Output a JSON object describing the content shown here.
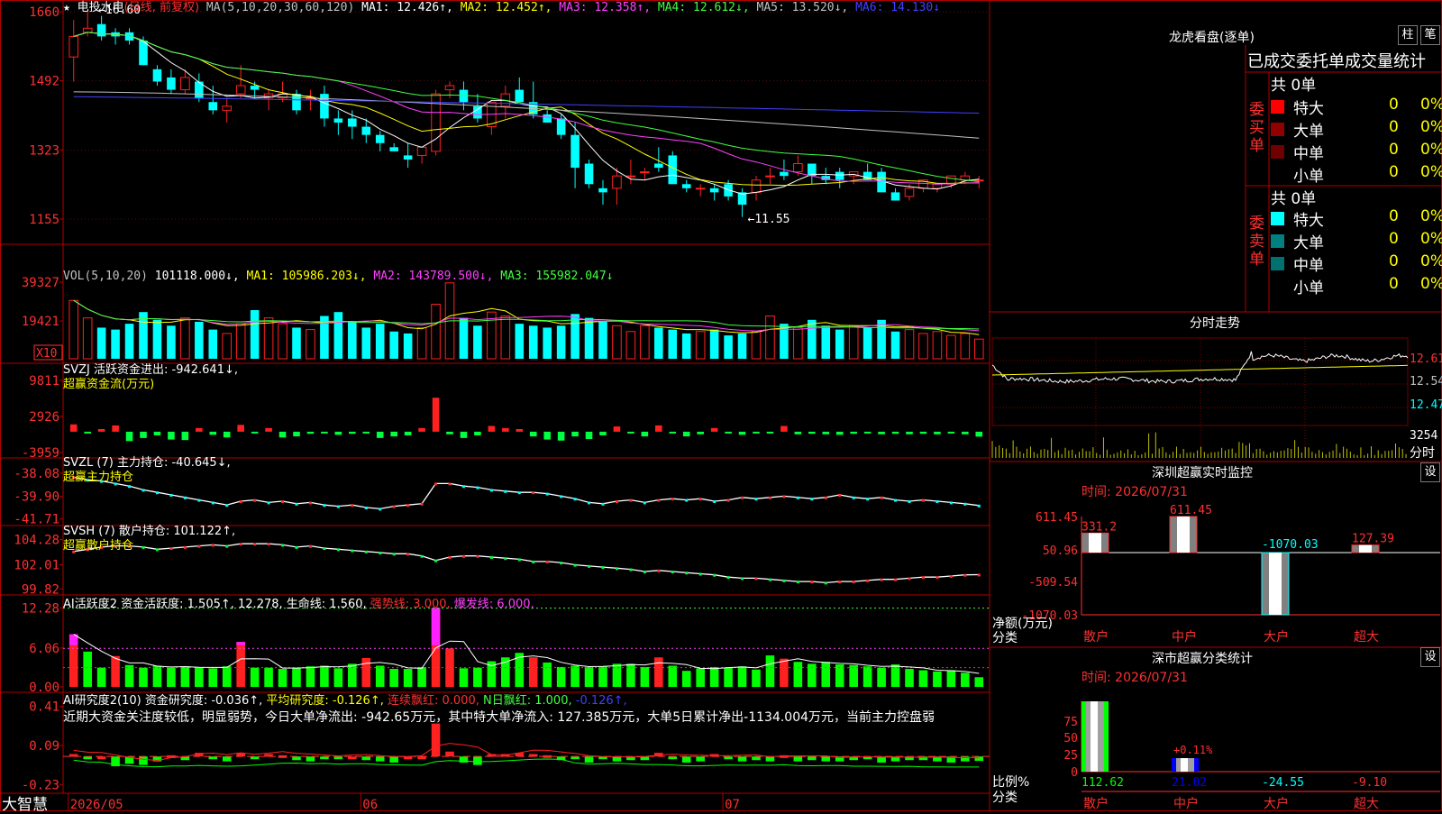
{
  "stock": {
    "name": "电投水电",
    "period": "(日线, 前复权)",
    "star": "★"
  },
  "colors": {
    "up": "#ff2020",
    "down": "#00ffff",
    "ma1": "#ffffff",
    "ma2": "#ffff00",
    "ma3": "#ff40ff",
    "ma4": "#40ff40",
    "ma5": "#c0c0c0",
    "ma6": "#4040ff",
    "grid": "#a01010",
    "border": "#b00000"
  },
  "ma_header": {
    "params": "MA(5,10,20,30,60,120)",
    "items": [
      {
        "label": "MA1:",
        "value": "12.426↑,",
        "color": "#ffffff"
      },
      {
        "label": "MA2:",
        "value": "12.452↑,",
        "color": "#ffff00"
      },
      {
        "label": "MA3:",
        "value": "12.358↑,",
        "color": "#ff40ff"
      },
      {
        "label": "MA4:",
        "value": "12.612↓,",
        "color": "#40ff40"
      },
      {
        "label": "MA5:",
        "value": "13.520↓,",
        "color": "#c0c0c0"
      },
      {
        "label": "MA6:",
        "value": "14.130↓",
        "color": "#4040ff"
      }
    ]
  },
  "vol_header": {
    "params": "VOL(5,10,20)",
    "value": "101118.000↓,",
    "items": [
      {
        "label": "MA1:",
        "value": "105986.203↓,",
        "color": "#ffff00"
      },
      {
        "label": "MA2:",
        "value": "143789.500↓,",
        "color": "#ff40ff"
      },
      {
        "label": "MA3:",
        "value": "155982.047↓",
        "color": "#40ff40"
      }
    ]
  },
  "svzj_header": {
    "line1": "SVZJ  活跃资金进出: -942.641↓,",
    "line2": "超赢资金流(万元)"
  },
  "svzl_header": {
    "line1": "SVZL (7) 主力持仓: -40.645↓,",
    "line2": "超赢主力持仓"
  },
  "svsh_header": {
    "line1": "SVSH (7) 散户持仓: 101.122↑,",
    "line2": "超赢散户持仓"
  },
  "ai1_header": {
    "a": "AI活跃度2 资金活跃度: 1.505↑, 12.278, 生命线: 1.560,",
    "b": "强势线: 3.000,",
    "c": "爆发线: 6.000,"
  },
  "ai2_header": {
    "a": "AI研究度2(10) 资金研究度: -0.036↑,",
    "b": "平均研究度: -0.126↑,",
    "c": "连续飘红: 0.000,",
    "d": "N日飘红: 1.000,",
    "e": "-0.126↑,"
  },
  "ai2_comment": "近期大资金关注度较低，明显弱势，今日大单净流出: -942.65万元，其中特大单净流入: 127.385万元，大单5日累计净出-1134.004万元，当前主力控盘弱",
  "axes": {
    "price": [
      "1660",
      "1492",
      "1323",
      "1155"
    ],
    "vol": [
      "39327",
      "19421"
    ],
    "vol_unit": "X10",
    "svzj": [
      "9811",
      "2926",
      "-3959"
    ],
    "svzl": [
      "-38.08",
      "-39.90",
      "-41.71"
    ],
    "svsh": [
      "104.28",
      "102.01",
      "99.82"
    ],
    "ai1": [
      "12.28",
      "6.06",
      "0.00"
    ],
    "ai2": [
      "0.41",
      "0.09",
      "-0.23"
    ],
    "dates": [
      "2026/05",
      "06",
      "07"
    ]
  },
  "price_annotations": {
    "high": "16.60",
    "low": "11.55"
  },
  "brand": "大智慧",
  "right_panel": {
    "lhb": {
      "title": "龙虎看盘(逐单)",
      "btn1": "柱",
      "btn2": "笔",
      "tabs": "已成交委托单成交量统计",
      "buy": {
        "side": "委买单",
        "total": "共 0单",
        "rows": [
          {
            "label": "特大",
            "v": "0",
            "p": "0%",
            "color": "#ff0000"
          },
          {
            "label": "大单",
            "v": "0",
            "p": "0%",
            "color": "#900000"
          },
          {
            "label": "中单",
            "v": "0",
            "p": "0%",
            "color": "#700000"
          },
          {
            "label": "小单",
            "v": "0",
            "p": "0%",
            "color": ""
          }
        ]
      },
      "sell": {
        "side": "委卖单",
        "total": "共 0单",
        "rows": [
          {
            "label": "特大",
            "v": "0",
            "p": "0%",
            "color": "#00ffff"
          },
          {
            "label": "大单",
            "v": "0",
            "p": "0%",
            "color": "#008080"
          },
          {
            "label": "中单",
            "v": "0",
            "p": "0%",
            "color": "#007070"
          },
          {
            "label": "小单",
            "v": "0",
            "p": "0%",
            "color": ""
          }
        ]
      }
    },
    "fenshi": {
      "title": "分时走势",
      "prices": [
        "12.61",
        "12.54",
        "12.47"
      ],
      "vol": "3254",
      "vol_label": "分时"
    },
    "monitor": {
      "title": "深圳超赢实时监控",
      "btn": "设",
      "time": "时间: 2026/07/31",
      "yaxis": [
        "611.45",
        "50.96",
        "-509.54",
        "-1070.03"
      ],
      "ylabel": "净额(万元)",
      "xlabel": "分类"
    },
    "classify": {
      "title": "深市超赢分类统计",
      "btn": "设",
      "time": "时间: 2026/07/31",
      "yaxis": [
        "75",
        "50",
        "25",
        "0"
      ],
      "ylabel": "比例%",
      "xlabel": "分类",
      "annot": "+0.11%"
    }
  },
  "chart_data": [
    {
      "type": "candlestick",
      "name": "price",
      "title": "电投水电(日线, 前复权)",
      "ylim": [
        11.0,
        16.8
      ],
      "ticks": [
        16.6,
        14.92,
        13.23,
        11.55
      ],
      "ohlc": [
        [
          15.5,
          16.4,
          14.9,
          16.0
        ],
        [
          16.1,
          16.6,
          16.0,
          16.2
        ],
        [
          16.3,
          16.5,
          15.9,
          16.0
        ],
        [
          16.1,
          16.2,
          15.8,
          16.0
        ],
        [
          16.1,
          16.2,
          15.8,
          15.9
        ],
        [
          15.9,
          16.0,
          15.3,
          15.3
        ],
        [
          15.2,
          15.3,
          14.8,
          14.9
        ],
        [
          15.0,
          15.2,
          14.6,
          14.7
        ],
        [
          14.7,
          15.2,
          14.6,
          15.0
        ],
        [
          14.9,
          15.1,
          14.4,
          14.5
        ],
        [
          14.4,
          14.8,
          14.1,
          14.2
        ],
        [
          14.2,
          14.5,
          13.9,
          14.3
        ],
        [
          14.6,
          15.3,
          14.5,
          14.8
        ],
        [
          14.8,
          14.9,
          14.5,
          14.7
        ],
        [
          14.5,
          14.7,
          14.2,
          14.6
        ],
        [
          14.5,
          14.9,
          14.4,
          14.6
        ],
        [
          14.6,
          14.7,
          14.1,
          14.2
        ],
        [
          14.5,
          14.7,
          14.2,
          14.5
        ],
        [
          14.6,
          14.8,
          13.8,
          14.0
        ],
        [
          14.0,
          14.2,
          13.6,
          13.9
        ],
        [
          14.0,
          14.2,
          13.5,
          13.8
        ],
        [
          13.8,
          14.0,
          13.4,
          13.6
        ],
        [
          13.6,
          13.7,
          13.2,
          13.4
        ],
        [
          13.3,
          13.4,
          13.2,
          13.2
        ],
        [
          13.1,
          13.4,
          12.8,
          13.0
        ],
        [
          13.1,
          13.3,
          12.9,
          13.3
        ],
        [
          13.2,
          14.7,
          13.1,
          14.6
        ],
        [
          14.7,
          14.9,
          14.5,
          14.8
        ],
        [
          14.7,
          14.9,
          14.2,
          14.4
        ],
        [
          14.3,
          14.6,
          13.9,
          14.0
        ],
        [
          13.8,
          14.4,
          13.6,
          14.4
        ],
        [
          14.3,
          14.8,
          14.0,
          14.6
        ],
        [
          14.7,
          15.0,
          14.4,
          14.4
        ],
        [
          14.4,
          14.9,
          14.0,
          14.1
        ],
        [
          14.1,
          14.2,
          13.9,
          13.9
        ],
        [
          14.0,
          14.1,
          13.5,
          13.6
        ],
        [
          13.6,
          13.9,
          12.3,
          12.8
        ],
        [
          12.9,
          13.0,
          12.3,
          12.4
        ],
        [
          12.3,
          12.5,
          11.9,
          12.2
        ],
        [
          12.3,
          12.8,
          11.9,
          12.6
        ],
        [
          12.6,
          13.0,
          12.4,
          12.6
        ],
        [
          12.7,
          12.8,
          12.5,
          12.7
        ],
        [
          12.9,
          13.3,
          12.7,
          12.8
        ],
        [
          13.1,
          13.2,
          12.8,
          12.4
        ],
        [
          12.4,
          12.5,
          12.2,
          12.3
        ],
        [
          12.3,
          12.4,
          12.1,
          12.3
        ],
        [
          12.3,
          12.4,
          12.0,
          12.2
        ],
        [
          12.4,
          12.5,
          12.0,
          12.1
        ],
        [
          12.2,
          12.3,
          11.6,
          11.9
        ],
        [
          12.2,
          12.6,
          12.0,
          12.5
        ],
        [
          12.6,
          12.8,
          12.4,
          12.6
        ],
        [
          12.7,
          13.0,
          12.5,
          12.6
        ],
        [
          12.7,
          13.1,
          12.6,
          12.9
        ],
        [
          12.9,
          12.9,
          12.4,
          12.6
        ],
        [
          12.6,
          12.8,
          12.4,
          12.5
        ],
        [
          12.7,
          12.8,
          12.3,
          12.5
        ],
        [
          12.6,
          12.7,
          12.4,
          12.7
        ],
        [
          12.7,
          12.9,
          12.5,
          12.5
        ],
        [
          12.7,
          12.8,
          12.3,
          12.2
        ],
        [
          12.2,
          12.3,
          12.0,
          12.0
        ],
        [
          12.1,
          12.4,
          12.0,
          12.3
        ],
        [
          12.3,
          12.5,
          12.2,
          12.5
        ],
        [
          12.3,
          12.4,
          12.2,
          12.4
        ],
        [
          12.4,
          12.6,
          12.3,
          12.6
        ],
        [
          12.5,
          12.7,
          12.4,
          12.6
        ],
        [
          12.5,
          12.6,
          12.3,
          12.5
        ]
      ],
      "annotations": {
        "high": 16.6,
        "low": 11.55
      }
    },
    {
      "type": "bar",
      "name": "volume",
      "title": "VOL(5,10,20)",
      "unit": "X10",
      "ylim": [
        0,
        44000
      ],
      "values": [
        30000,
        21000,
        16000,
        15000,
        18000,
        24000,
        20000,
        17000,
        21000,
        19000,
        15000,
        13000,
        18000,
        25000,
        21000,
        18000,
        16000,
        15000,
        22000,
        24000,
        19000,
        16000,
        18000,
        14000,
        13000,
        16000,
        28000,
        39000,
        21000,
        17000,
        24000,
        22000,
        18000,
        17000,
        16000,
        17000,
        23000,
        21000,
        19000,
        17000,
        14000,
        17000,
        16000,
        15000,
        13000,
        14000,
        15000,
        12000,
        13000,
        14000,
        22000,
        18000,
        16000,
        20000,
        17000,
        15000,
        17000,
        16000,
        20000,
        14000,
        15000,
        13000,
        14000,
        12000,
        13000,
        10111.8
      ]
    },
    {
      "type": "bar",
      "name": "svzj",
      "title": "超赢资金流(万元)",
      "ylim": [
        -4500,
        10500
      ],
      "values": [
        1400,
        -300,
        500,
        1200,
        -1800,
        -1200,
        -700,
        -1500,
        -1600,
        700,
        -600,
        -1100,
        1300,
        -200,
        700,
        -1100,
        -900,
        -400,
        -300,
        -600,
        -400,
        -300,
        -1200,
        -900,
        -700,
        700,
        6500,
        -500,
        -1200,
        -700,
        1100,
        700,
        500,
        -900,
        -1500,
        -1700,
        -900,
        -1400,
        -700,
        1000,
        -300,
        -900,
        1200,
        -300,
        -900,
        -500,
        700,
        -200,
        -600,
        -300,
        -300,
        1100,
        -500,
        -400,
        -500,
        -600,
        -400,
        -300,
        -500,
        -400,
        -500,
        -400,
        -500,
        -300,
        -500,
        -942.641
      ]
    },
    {
      "type": "line",
      "name": "svzl",
      "title": "超赢主力持仓",
      "ylim": [
        -41.8,
        -37.8
      ],
      "values": [
        -38.4,
        -38.6,
        -38.7,
        -38.9,
        -39.1,
        -39.4,
        -39.6,
        -39.8,
        -40.0,
        -40.2,
        -40.4,
        -40.6,
        -40.3,
        -40.2,
        -40.4,
        -40.3,
        -40.5,
        -40.4,
        -40.6,
        -40.7,
        -40.6,
        -40.8,
        -40.9,
        -40.7,
        -40.6,
        -40.5,
        -38.9,
        -38.9,
        -39.1,
        -39.2,
        -39.4,
        -39.5,
        -39.6,
        -39.6,
        -39.7,
        -39.9,
        -40.1,
        -40.4,
        -40.5,
        -40.3,
        -40.2,
        -40.4,
        -40.2,
        -40.1,
        -40.2,
        -40.1,
        -40.3,
        -40.2,
        -40.0,
        -40.1,
        -40.0,
        -39.9,
        -40.0,
        -40.1,
        -40.0,
        -39.8,
        -40.0,
        -40.1,
        -40.0,
        -40.2,
        -40.3,
        -40.2,
        -40.3,
        -40.4,
        -40.5,
        -40.645
      ]
    },
    {
      "type": "line",
      "name": "svsh",
      "title": "超赢散户持仓",
      "ylim": [
        99.7,
        104.4
      ],
      "values": [
        103.2,
        103.4,
        103.6,
        103.7,
        103.7,
        103.6,
        103.4,
        103.5,
        103.6,
        103.7,
        103.8,
        103.7,
        103.9,
        103.9,
        103.9,
        103.8,
        103.6,
        103.7,
        103.5,
        103.4,
        103.3,
        103.2,
        103.1,
        103.0,
        103.0,
        102.8,
        102.4,
        102.7,
        102.8,
        102.8,
        102.7,
        102.6,
        102.5,
        102.3,
        102.3,
        102.2,
        102.0,
        101.9,
        101.8,
        101.7,
        101.6,
        101.4,
        101.5,
        101.4,
        101.3,
        101.2,
        101.1,
        100.9,
        100.8,
        100.8,
        100.7,
        100.6,
        100.5,
        100.5,
        100.4,
        100.5,
        100.5,
        100.6,
        100.7,
        100.7,
        100.8,
        100.9,
        100.9,
        101.0,
        101.1,
        101.122
      ]
    },
    {
      "type": "bar",
      "name": "ai_activity",
      "title": "AI活跃度2",
      "ylim": [
        0,
        12.5
      ],
      "values": [
        8.2,
        5.5,
        3.0,
        4.8,
        3.4,
        3.0,
        3.3,
        3.0,
        3.2,
        3.0,
        2.9,
        3.2,
        7.0,
        3.0,
        3.0,
        2.8,
        3.0,
        3.2,
        3.3,
        2.9,
        3.6,
        4.5,
        3.3,
        2.8,
        2.8,
        3.1,
        12.3,
        6.0,
        2.9,
        3.0,
        4.0,
        4.6,
        5.3,
        4.6,
        3.8,
        3.1,
        3.3,
        3.1,
        3.2,
        3.6,
        3.6,
        3.1,
        4.6,
        3.3,
        2.5,
        2.9,
        3.1,
        3.0,
        3.2,
        2.7,
        4.9,
        4.4,
        3.9,
        3.6,
        3.9,
        3.5,
        3.4,
        3.2,
        3.0,
        3.5,
        2.8,
        2.6,
        2.4,
        2.6,
        2.2,
        1.505
      ],
      "lines": {
        "强势线": 3.0,
        "爆发线": 6.0
      }
    },
    {
      "type": "bar",
      "name": "ai_research",
      "title": "AI研究度2(10)",
      "ylim": [
        -0.25,
        0.43
      ],
      "values": [
        0.02,
        -0.01,
        0.0,
        -0.08,
        -0.06,
        -0.07,
        -0.04,
        0.01,
        -0.03,
        0.03,
        -0.02,
        -0.04,
        0.03,
        -0.02,
        0.02,
        0.01,
        -0.03,
        -0.04,
        -0.01,
        -0.02,
        0.0,
        -0.03,
        -0.04,
        -0.05,
        0.0,
        0.0,
        0.27,
        0.04,
        -0.05,
        -0.07,
        0.02,
        0.02,
        0.03,
        0.02,
        0.01,
        -0.03,
        -0.02,
        -0.05,
        -0.02,
        -0.04,
        -0.03,
        -0.03,
        0.03,
        -0.02,
        -0.05,
        -0.04,
        0.02,
        -0.02,
        -0.04,
        -0.03,
        -0.04,
        0.01,
        -0.04,
        -0.03,
        -0.04,
        -0.04,
        -0.03,
        -0.02,
        -0.05,
        -0.04,
        -0.03,
        -0.03,
        -0.04,
        -0.05,
        -0.04,
        -0.036
      ]
    },
    {
      "type": "bar",
      "name": "monitor",
      "title": "深圳超赢实时监控",
      "ylim": [
        -1070.03,
        611.45
      ],
      "categories": [
        "散户",
        "中户",
        "大户",
        "超大"
      ],
      "values": [
        331.2,
        611.45,
        -1070.03,
        127.39
      ],
      "labels": [
        "331.2",
        "611.45",
        "-1070.03",
        "127.39"
      ]
    },
    {
      "type": "bar",
      "name": "classify",
      "title": "深市超赢分类统计",
      "ylim": [
        0,
        100
      ],
      "categories": [
        "散户",
        "中户",
        "大户",
        "超大"
      ],
      "values": [
        112.62,
        21.02,
        -24.55,
        -9.1
      ],
      "labels": [
        "112.62",
        "21.02",
        "-24.55",
        "-9.10"
      ]
    },
    {
      "type": "line",
      "name": "fenshi",
      "title": "分时走势",
      "ylim": [
        12.4,
        12.66
      ]
    }
  ]
}
